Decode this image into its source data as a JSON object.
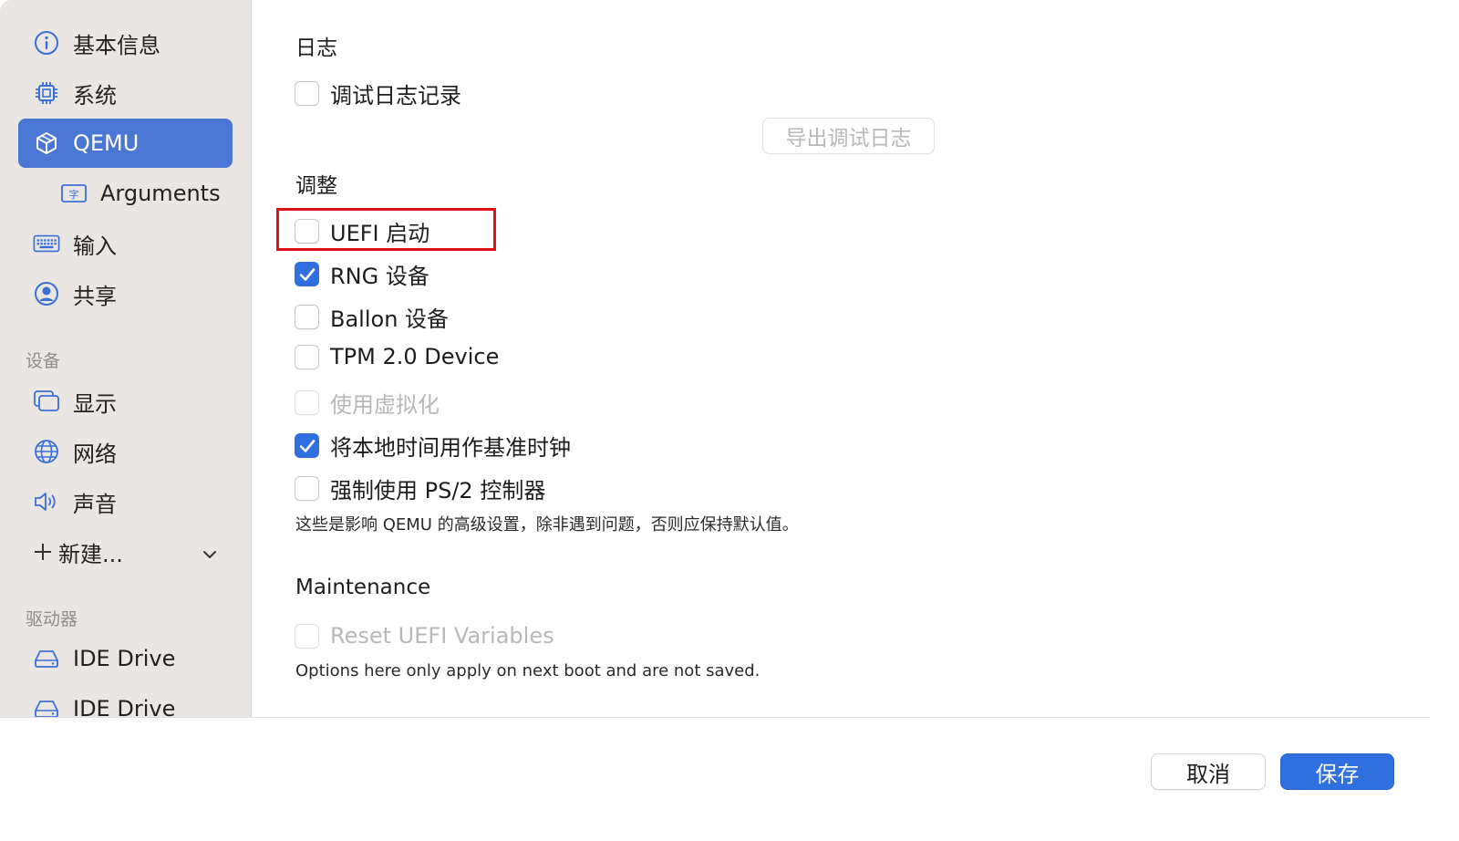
{
  "sidebar": {
    "items": [
      {
        "label": "基本信息",
        "icon": "info-icon"
      },
      {
        "label": "系统",
        "icon": "cpu-icon"
      },
      {
        "label": "QEMU",
        "icon": "cube-icon",
        "selected": true
      },
      {
        "label": "Arguments",
        "icon": "text-field-icon"
      },
      {
        "label": "输入",
        "icon": "keyboard-icon"
      },
      {
        "label": "共享",
        "icon": "person-circle-icon"
      }
    ],
    "devices_header": "设备",
    "devices": [
      {
        "label": "显示",
        "icon": "display-icon"
      },
      {
        "label": "网络",
        "icon": "globe-icon"
      },
      {
        "label": "声音",
        "icon": "speaker-icon"
      }
    ],
    "new_label": "新建...",
    "drives_header": "驱动器",
    "drives": [
      {
        "label": "IDE Drive",
        "icon": "drive-icon"
      },
      {
        "label": "IDE Drive",
        "icon": "drive-icon"
      }
    ]
  },
  "main": {
    "log_heading": "日志",
    "debug_log_label": "调试日志记录",
    "debug_log_checked": false,
    "export_button": "导出调试日志",
    "tweaks_heading": "调整",
    "options": [
      {
        "label": "UEFI 启动",
        "checked": false,
        "disabled": false
      },
      {
        "label": "RNG 设备",
        "checked": true,
        "disabled": false
      },
      {
        "label": "Ballon 设备",
        "checked": false,
        "disabled": false
      },
      {
        "label": "TPM 2.0 Device",
        "checked": false,
        "disabled": false
      },
      {
        "label": "使用虚拟化",
        "checked": false,
        "disabled": true
      },
      {
        "label": "将本地时间用作基准时钟",
        "checked": true,
        "disabled": false
      },
      {
        "label": "强制使用 PS/2 控制器",
        "checked": false,
        "disabled": false
      }
    ],
    "tweaks_note": "这些是影响 QEMU 的高级设置，除非遇到问题，否则应保持默认值。",
    "maintenance_heading": "Maintenance",
    "reset_uefi_label": "Reset UEFI Variables",
    "reset_uefi_disabled": true,
    "maintenance_note": "Options here only apply on next boot and are not saved."
  },
  "footer": {
    "cancel_label": "取消",
    "save_label": "保存"
  },
  "colors": {
    "accent": "#2f6fe0",
    "sidebar_selected": "#4a77d4",
    "sidebar_bg": "#eae6e3",
    "highlight": "#e0101a"
  }
}
